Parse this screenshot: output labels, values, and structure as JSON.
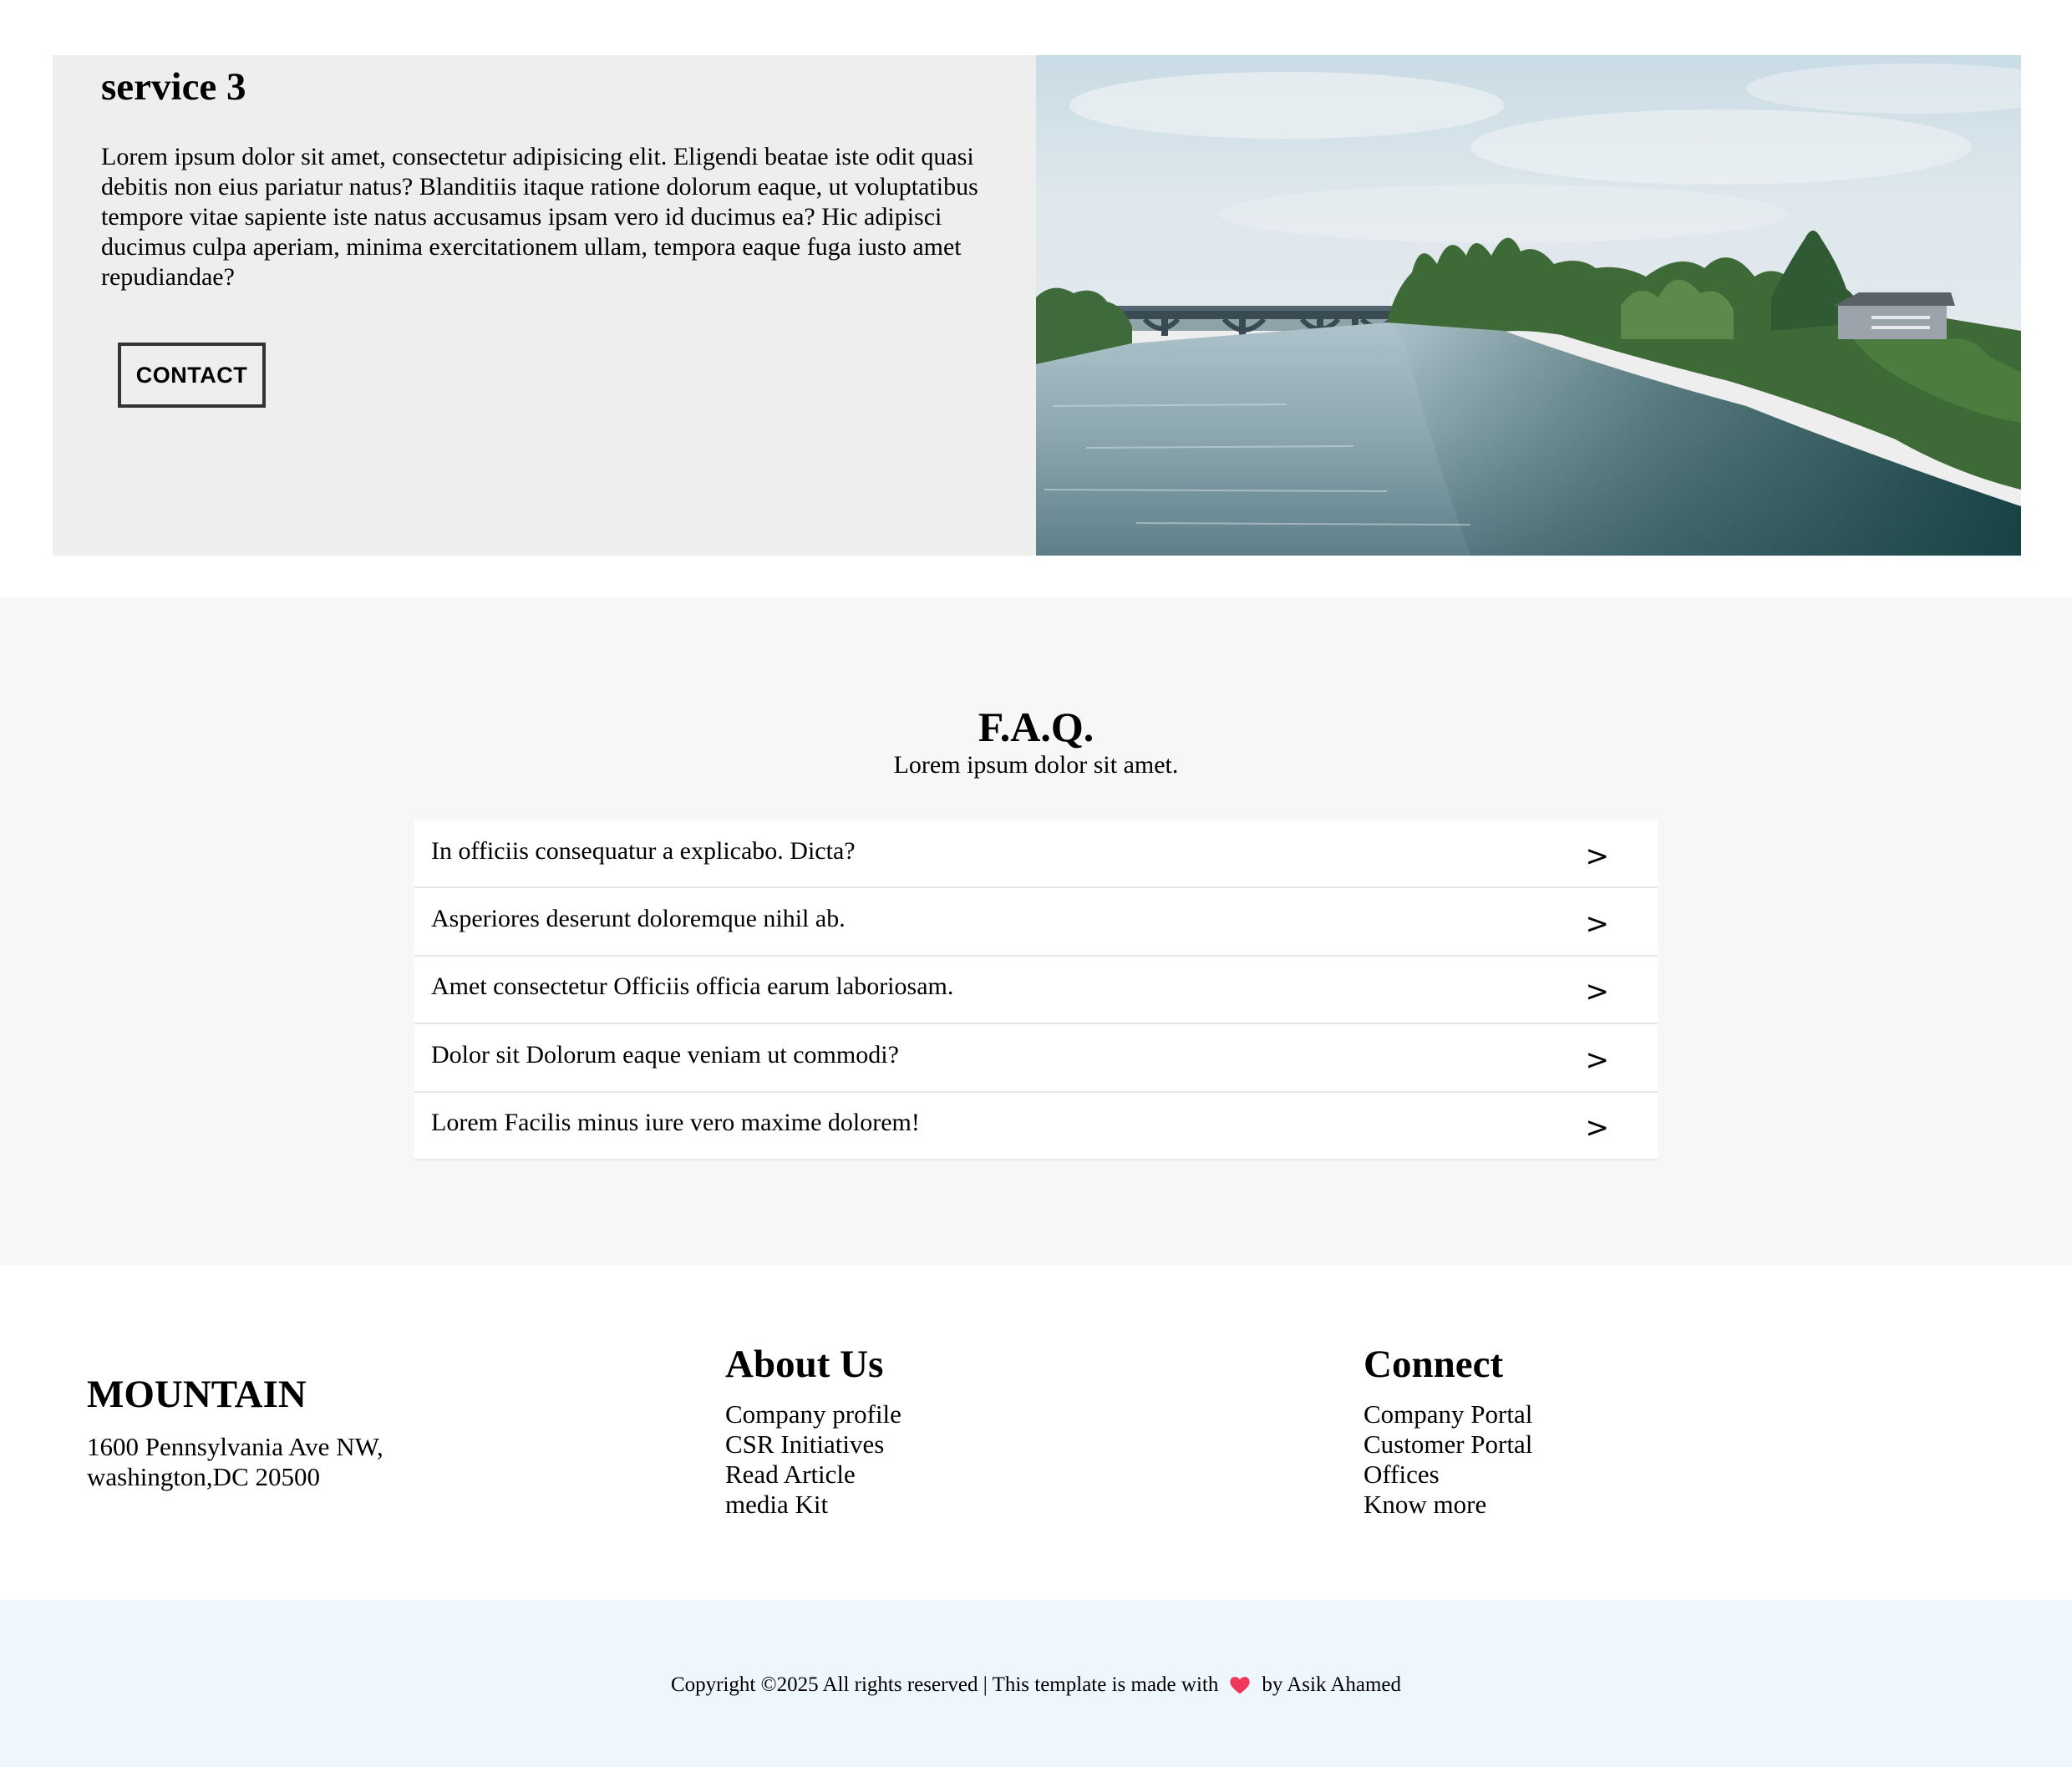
{
  "service": {
    "title": "service 3",
    "body": "Lorem ipsum dolor sit amet, consectetur adipisicing elit. Eligendi beatae iste odit quasi debitis non eius pariatur natus? Blanditiis itaque ratione dolorum eaque, ut voluptatibus tempore vitae sapiente iste natus accusamus ipsam vero id ducimus ea? Hic adipisci ducimus culpa aperiam, minima exercitationem ullam, tempora eaque fuga iusto amet repudiandae?",
    "contact_label": "CONTACT",
    "image_subject": "river-bridge-photo"
  },
  "faq": {
    "title": "F.A.Q.",
    "subtitle": "Lorem ipsum dolor sit amet.",
    "chevron": ">",
    "items": [
      {
        "question": "In officiis consequatur a explicabo. Dicta?"
      },
      {
        "question": "Asperiores deserunt doloremque nihil ab."
      },
      {
        "question": "Amet consectetur Officiis officia earum laboriosam."
      },
      {
        "question": "Dolor sit Dolorum eaque veniam ut commodi?"
      },
      {
        "question": "Lorem Facilis minus iure vero maxime dolorem!"
      }
    ]
  },
  "footer": {
    "brand": "MOUNTAIN",
    "address_line1": "1600 Pennsylvania Ave NW,",
    "address_line2": "washington,DC 20500",
    "about": {
      "title": "About Us",
      "links": [
        "Company profile",
        "CSR Initiatives",
        "Read Article",
        "media Kit"
      ]
    },
    "connect": {
      "title": "Connect",
      "links": [
        "Company Portal",
        "Customer Portal",
        "Offices",
        "Know more"
      ]
    }
  },
  "copyright": {
    "prefix": "Copyright ©2025 All rights reserved | This template is made with",
    "suffix": "by Asik Ahamed",
    "heart_icon": "heart-icon",
    "heart_color": "#f2385a"
  },
  "colors": {
    "service_bg": "#eeeeee",
    "faq_bg": "#f7f7f7",
    "copyright_bg": "#eff7fe"
  }
}
